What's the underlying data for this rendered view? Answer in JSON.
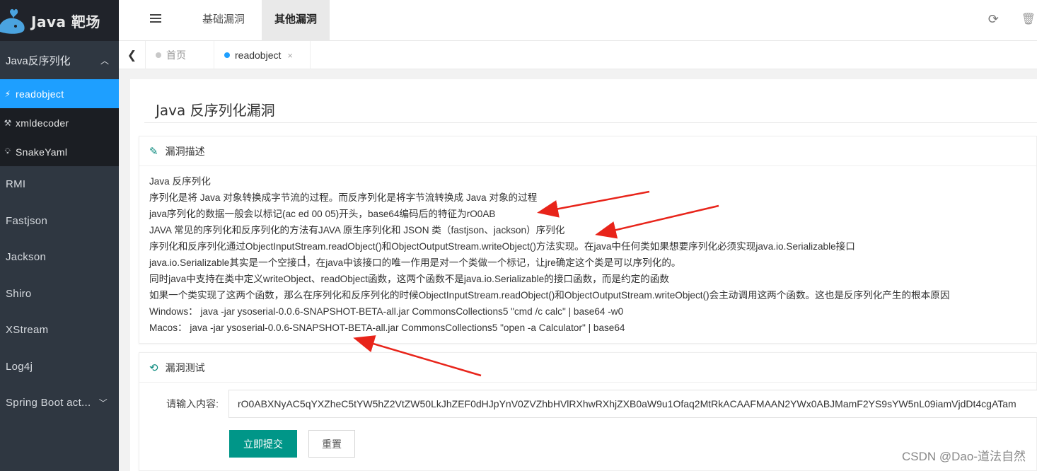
{
  "app": {
    "logo_text": "Java 靶场"
  },
  "sidebar": {
    "group": {
      "label": "Java反序列化"
    },
    "sub_items": [
      {
        "label": "readobject",
        "icon": "lightning-icon",
        "active": true
      },
      {
        "label": "xmldecoder",
        "icon": "hammer-icon",
        "active": false
      },
      {
        "label": "SnakeYaml",
        "icon": "bulb-icon",
        "active": false
      }
    ],
    "items": [
      {
        "label": "RMI"
      },
      {
        "label": "Fastjson"
      },
      {
        "label": "Jackson"
      },
      {
        "label": "Shiro"
      },
      {
        "label": "XStream"
      },
      {
        "label": "Log4j"
      },
      {
        "label": "Spring Boot act..."
      }
    ]
  },
  "header": {
    "tabs": [
      {
        "label": "基础漏洞",
        "active": false
      },
      {
        "label": "其他漏洞",
        "active": true
      }
    ]
  },
  "tabbar": {
    "tabs": [
      {
        "label": "首页",
        "active": false
      },
      {
        "label": "readobject",
        "active": true,
        "close": "×"
      }
    ]
  },
  "main": {
    "title": "Java 反序列化漏洞",
    "description": {
      "heading": "漏洞描述",
      "lines": [
        "Java 反序列化",
        "序列化是将 Java 对象转换成字节流的过程。而反序列化是将字节流转换成 Java 对象的过程",
        "java序列化的数据一般会以标记(ac ed 00 05)开头，base64编码后的特征为rO0AB",
        "JAVA 常见的序列化和反序列化的方法有JAVA 原生序列化和 JSON 类（fastjson、jackson）序列化",
        "序列化和反序列化通过ObjectInputStream.readObject()和ObjectOutputStream.writeObject()方法实现。在java中任何类如果想要序列化必须实现java.io.Serializable接口",
        "java.io.Serializable其实是一个空接口，在java中该接口的唯一作用是对一个类做一个标记，让jre确定这个类是可以序列化的。",
        "同时java中支持在类中定义writeObject、readObject函数，这两个函数不是java.io.Serializable的接口函数，而是约定的函数",
        "如果一个类实现了这两个函数，那么在序列化和反序列化的时候ObjectInputStream.readObject()和ObjectOutputStream.writeObject()会主动调用这两个函数。这也是反序列化产生的根本原因",
        "Windows：  java -jar ysoserial-0.0.6-SNAPSHOT-BETA-all.jar CommonsCollections5 \"cmd /c calc\" | base64 -w0",
        "Macos：  java -jar ysoserial-0.0.6-SNAPSHOT-BETA-all.jar CommonsCollections5 \"open -a Calculator\" | base64"
      ]
    },
    "test": {
      "heading": "漏洞测试",
      "input_label": "请输入内容:",
      "input_value": "rO0ABXNyAC5qYXZheC5tYW5hZ2VtZW50LkJhZEF0dHJpYnV0ZVZhbHVlRXhwRXhjZXB0aW9u1Ofaq2MtRkACAAFMAAN2YWx0ABJMamF2YS9sYW5nL09iamVjdDt4cgATam",
      "submit_label": "立即提交",
      "reset_label": "重置"
    }
  },
  "watermark": "CSDN @Dao-道法自然",
  "colors": {
    "accent": "#1e9fff",
    "submit": "#009688",
    "sidebar": "#2f3741",
    "arrow": "#e8241a"
  }
}
